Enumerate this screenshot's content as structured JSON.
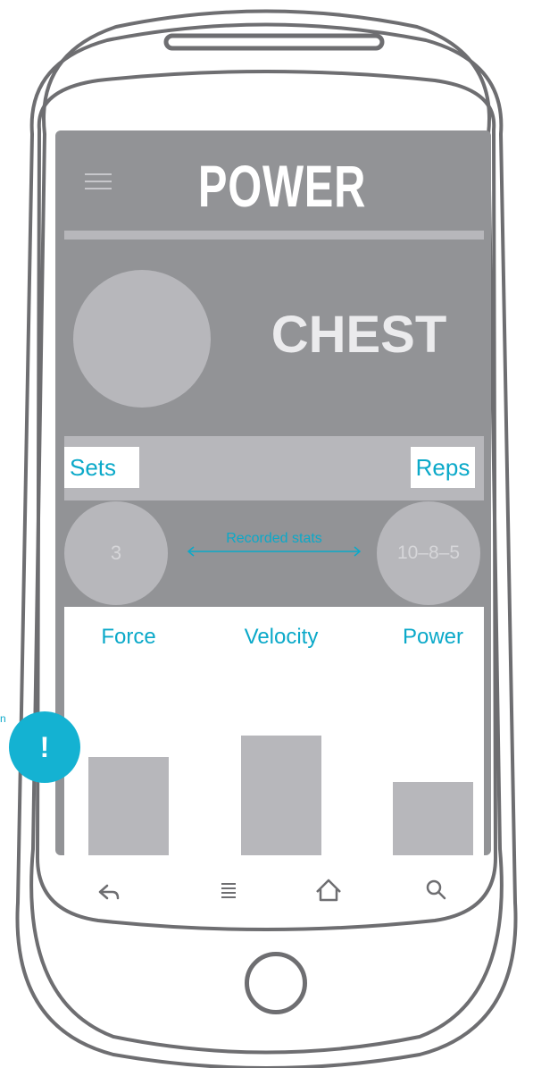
{
  "app": {
    "title": "POWER"
  },
  "exercise": {
    "muscle": "CHEST"
  },
  "stats": {
    "sets_label": "Sets",
    "reps_label": "Reps",
    "sets_value": "3",
    "reps_value": "10–8–5",
    "recorded_label": "Recorded stats"
  },
  "chart_data": {
    "type": "bar",
    "categories": [
      "Force",
      "Velocity",
      "Power"
    ],
    "values": [
      0.55,
      0.67,
      0.41
    ],
    "ylim": [
      0,
      1
    ]
  },
  "alert": {
    "symbol": "!",
    "side_text": "n"
  },
  "nav": {
    "back_icon": "back-arrow-icon",
    "menu_icon": "list-menu-icon",
    "home_icon": "home-icon",
    "search_icon": "search-icon"
  },
  "colors": {
    "accent": "#0ba9c9",
    "screen_bg": "#929396",
    "muted": "#b7b7bb"
  }
}
